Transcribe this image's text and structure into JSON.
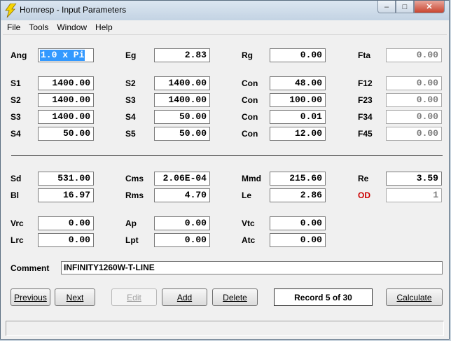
{
  "window": {
    "title": "Hornresp - Input Parameters",
    "min_glyph": "–",
    "max_glyph": "□",
    "close_glyph": "✕"
  },
  "menu": [
    "File",
    "Tools",
    "Window",
    "Help"
  ],
  "horn": {
    "Ang": "1.0 x Pi",
    "Eg": "2.83",
    "Rg": "0.00",
    "Fta": "0.00",
    "S1": "1400.00",
    "S2_a": "1400.00",
    "Con_1": "48.00",
    "F12": "0.00",
    "S2_b": "1400.00",
    "S3_a": "1400.00",
    "Con_2": "100.00",
    "F23": "0.00",
    "S3_b": "1400.00",
    "S4_a": "50.00",
    "Con_3": "0.01",
    "F34": "0.00",
    "S4_b": "50.00",
    "S5": "50.00",
    "Con_4": "12.00",
    "F45": "0.00"
  },
  "driver": {
    "Sd": "531.00",
    "Cms": "2.06E-04",
    "Mmd": "215.60",
    "Re": "3.59",
    "Bl": "16.97",
    "Rms": "4.70",
    "Le": "2.86",
    "OD": "1"
  },
  "chamber": {
    "Vrc": "0.00",
    "Ap": "0.00",
    "Vtc": "0.00",
    "Lrc": "0.00",
    "Lpt": "0.00",
    "Atc": "0.00"
  },
  "labels": {
    "Ang": "Ang",
    "Eg": "Eg",
    "Rg": "Rg",
    "Fta": "Fta",
    "S1": "S1",
    "S2": "S2",
    "S3": "S3",
    "S4": "S4",
    "S5": "S5",
    "Con": "Con",
    "F12": "F12",
    "F23": "F23",
    "F34": "F34",
    "F45": "F45",
    "Sd": "Sd",
    "Cms": "Cms",
    "Mmd": "Mmd",
    "Re": "Re",
    "Bl": "Bl",
    "Rms": "Rms",
    "Le": "Le",
    "OD": "OD",
    "Vrc": "Vrc",
    "Ap": "Ap",
    "Vtc": "Vtc",
    "Lrc": "Lrc",
    "Lpt": "Lpt",
    "Atc": "Atc",
    "Comment": "Comment"
  },
  "comment": "INFINITY1260W-T-LINE",
  "buttons": {
    "previous": "Previous",
    "next": "Next",
    "edit": "Edit",
    "add": "Add",
    "delete": "Delete",
    "calculate": "Calculate"
  },
  "record": "Record 5 of 30",
  "colors": {
    "od_label": "#cc0000",
    "selection": "#3399ff"
  }
}
